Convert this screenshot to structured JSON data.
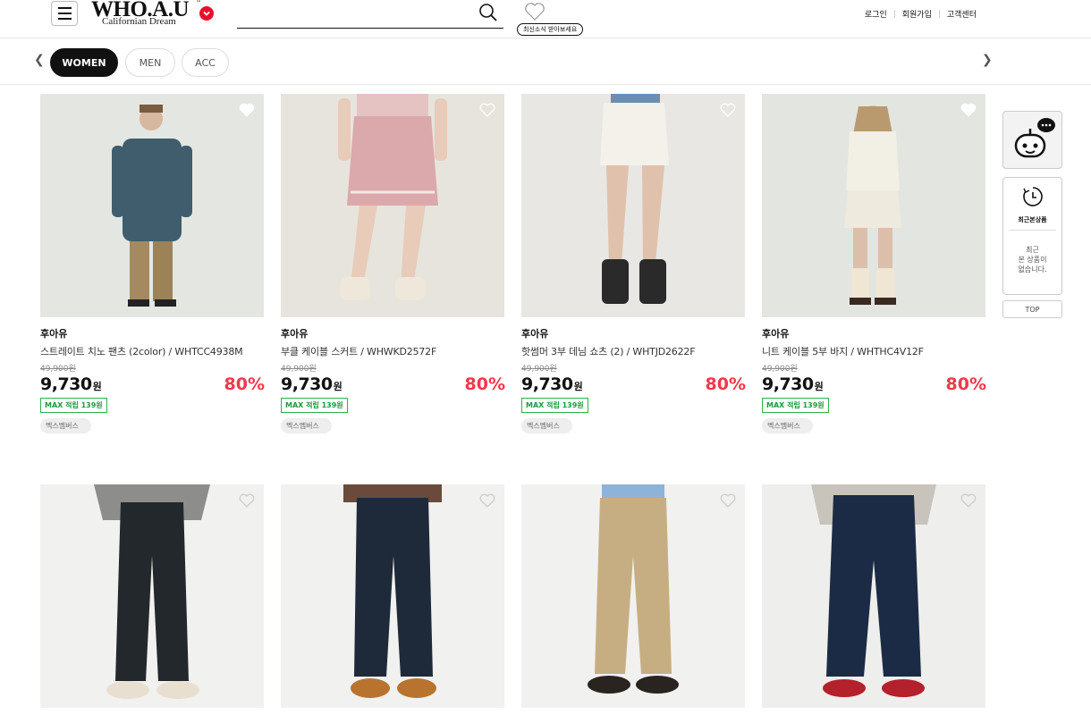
{
  "header": {
    "logo_main": "WHO.A.U",
    "logo_sub": "Californian Dream",
    "logo_tm": "™",
    "search_placeholder": "",
    "notify_label": "최신소식 받아보세요",
    "links": [
      "로그인",
      "회원가입",
      "고객센터"
    ]
  },
  "tabs": [
    {
      "label": "WOMEN",
      "active": true
    },
    {
      "label": "MEN",
      "active": false
    },
    {
      "label": "ACC",
      "active": false
    }
  ],
  "products": [
    {
      "brand": "후아유",
      "name": "스트레이트 치노 팬츠 (2color) / WHTCC4938M",
      "orig_price": "49,900원",
      "price": "9,730",
      "currency": "원",
      "discount": "80%",
      "max_badge": "MAX 적립 139원",
      "member_badge": "멕스멤버스",
      "wish_filled": true
    },
    {
      "brand": "후아유",
      "name": "부클 케이블 스커트 / WHWKD2572F",
      "orig_price": "49,900원",
      "price": "9,730",
      "currency": "원",
      "discount": "80%",
      "max_badge": "MAX 적립 139원",
      "member_badge": "멕스멤버스",
      "wish_filled": false
    },
    {
      "brand": "후아유",
      "name": "핫썸머 3부 데님 쇼츠 (2) / WHTJD2622F",
      "orig_price": "49,900원",
      "price": "9,730",
      "currency": "원",
      "discount": "80%",
      "max_badge": "MAX 적립 139원",
      "member_badge": "멕스멤버스",
      "wish_filled": false
    },
    {
      "brand": "후아유",
      "name": "니트 케이블 5부 바지 / WHTHC4V12F",
      "orig_price": "49,900원",
      "price": "9,730",
      "currency": "원",
      "discount": "80%",
      "max_badge": "MAX 적립 139원",
      "member_badge": "멕스멤버스",
      "wish_filled": true
    }
  ],
  "side": {
    "recent_title": "최근본상품",
    "recent_empty": "최근\n본 상품이\n없습니다.",
    "top_label": "TOP"
  },
  "colors": {
    "accent_red": "#f2384b",
    "badge_green": "#2bb24c",
    "logo_red": "#e8112d"
  },
  "icons": {
    "menu": "hamburger-icon",
    "search": "search-icon",
    "notify": "heart-outline-icon",
    "wish": "heart-icon",
    "bot": "chatbot-icon",
    "recent": "clock-icon"
  }
}
